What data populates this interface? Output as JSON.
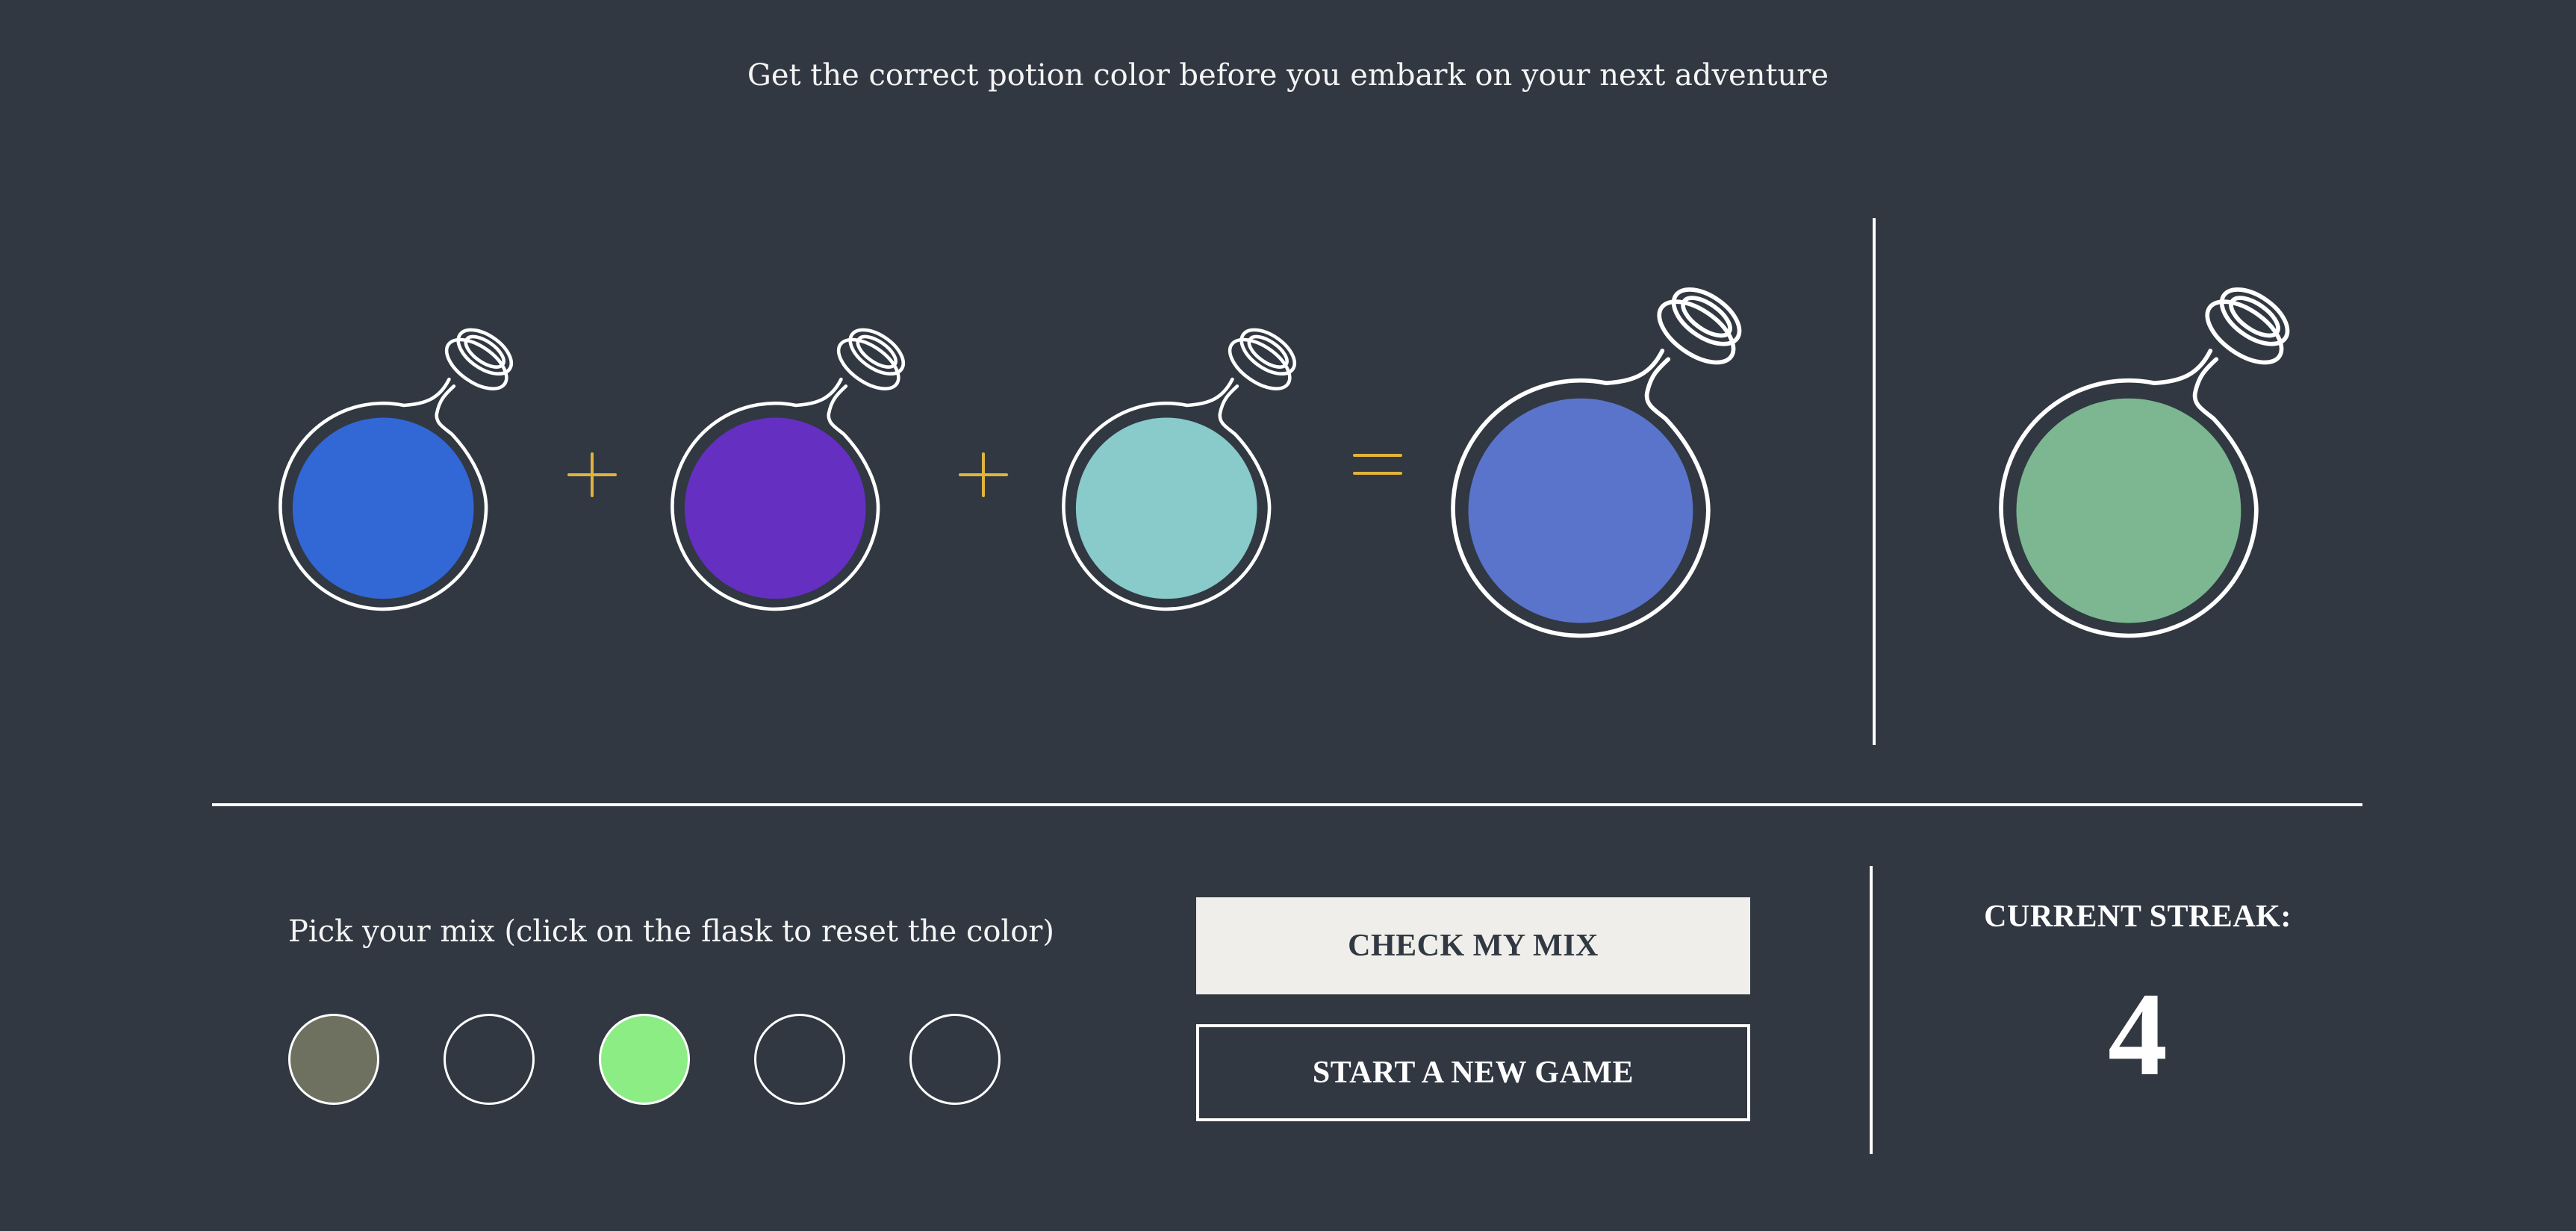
{
  "header": {
    "subtitle": "Get the correct potion color before you embark on your next adventure"
  },
  "mix": {
    "flasks": [
      {
        "name": "flask-1",
        "color": "#3267d6"
      },
      {
        "name": "flask-2",
        "color": "#652fc2"
      },
      {
        "name": "flask-3",
        "color": "#89cacb"
      }
    ],
    "operators": [
      "plus",
      "plus",
      "equals"
    ],
    "result_color": "#5a74cc",
    "target_color": "#7cb791",
    "operator_color": "#e0b43c"
  },
  "picker": {
    "label": "Pick your mix (click on the flask to reset the color)",
    "swatches": [
      {
        "color": "#6f7160",
        "empty": false
      },
      {
        "color": "",
        "empty": true
      },
      {
        "color": "#8ded85",
        "empty": false
      },
      {
        "color": "",
        "empty": true
      },
      {
        "color": "",
        "empty": true
      }
    ]
  },
  "actions": {
    "check_label": "CHECK MY MIX",
    "new_game_label": "START A NEW GAME"
  },
  "streak": {
    "label": "CURRENT STREAK:",
    "value": "4"
  }
}
